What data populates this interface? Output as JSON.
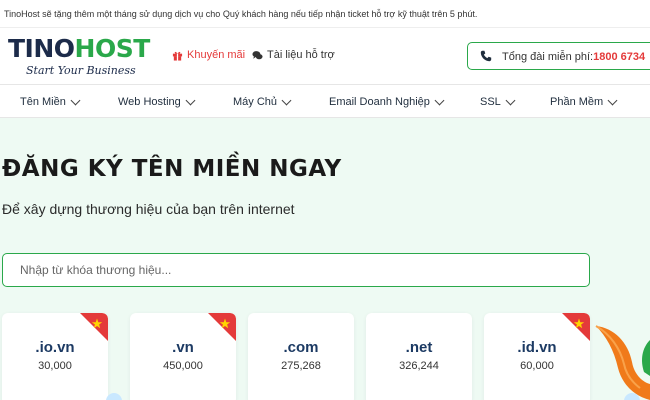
{
  "notice": "TinoHost sẽ tặng thêm một tháng sử dụng dịch vụ cho Quý khách hàng nếu tiếp nhận ticket hỗ trợ kỹ thuật trên 5 phút.",
  "logo": {
    "part1": "TINO",
    "part2": "HOST",
    "tagline": "Start Your Business"
  },
  "header_links": {
    "promo": "Khuyến mãi",
    "docs": "Tài liệu hỗ trợ"
  },
  "hotline": {
    "label": "Tổng đài miễn phí:",
    "number": "1800 6734"
  },
  "nav": [
    "Tên Miền",
    "Web Hosting",
    "Máy Chủ",
    "Email Doanh Nghiệp",
    "SSL",
    "Phần Mềm"
  ],
  "hero": {
    "title": "ĐĂNG KÝ TÊN MIỀN NGAY",
    "subtitle": "Để xây dựng thương hiệu của bạn trên internet"
  },
  "search": {
    "placeholder": "Nhập từ khóa thương hiệu...",
    "value": ""
  },
  "domains": [
    {
      "ext": ".io.vn",
      "price": "30,000",
      "badge": true
    },
    {
      "ext": ".vn",
      "price": "450,000",
      "badge": true
    },
    {
      "ext": ".com",
      "price": "275,268",
      "badge": false
    },
    {
      "ext": ".net",
      "price": "326,244",
      "badge": false
    },
    {
      "ext": ".id.vn",
      "price": "60,000",
      "badge": true
    }
  ],
  "colors": {
    "brand_green": "#2aa84a",
    "brand_navy": "#1c2b4a",
    "accent_red": "#e43a3a",
    "hero_bg": "#eefaf3",
    "star_yellow": "#ffd400"
  },
  "icons": {
    "promo": "gift-icon",
    "docs": "chat-bubbles-icon",
    "hotline": "phone-icon",
    "badge": "vietnam-flag-star-icon"
  }
}
